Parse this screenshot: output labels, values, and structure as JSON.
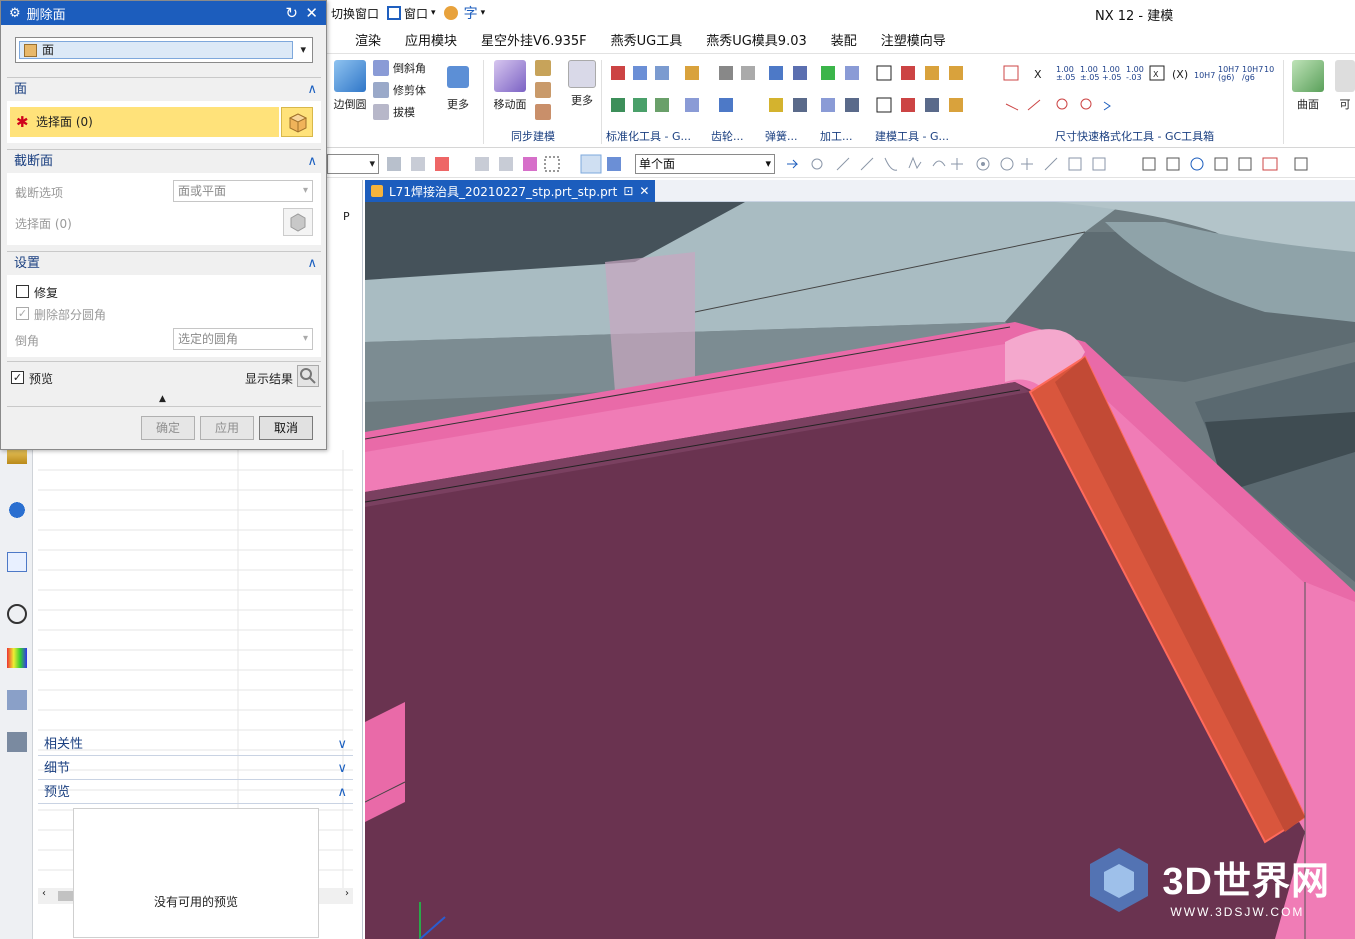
{
  "window": {
    "app_title": "NX 12 - 建模",
    "switch_window": "切换窗口",
    "window_menu": "窗口",
    "font_glyph": "字"
  },
  "menubar": [
    "渲染",
    "应用模块",
    "星空外挂V6.935F",
    "燕秀UG工具",
    "燕秀UG模具9.03",
    "装配",
    "注塑模向导"
  ],
  "ribbon": {
    "side_face": "边倒圆",
    "chamfer": "倒斜角",
    "trim_body": "修剪体",
    "draft": "拔模",
    "more_1": "更多",
    "move_face": "移动面",
    "more_2": "更多",
    "sync_modeling": "同步建模",
    "std_tools": "标准化工具 - G...",
    "gear": "齿轮...",
    "spring": "弹簧...",
    "machining": "加工...",
    "modeling_tools": "建模工具 - G...",
    "dim_tools": "尺寸快速格式化工具 - GC工具箱",
    "surface": "曲面",
    "right_cut": "可"
  },
  "toolbar2": {
    "filter_select": "单个面"
  },
  "doc_tab": {
    "name": "L71焊接治具_20210227_stp.prt_stp.prt"
  },
  "dialog": {
    "title": "删除面",
    "type_value": "面",
    "face_group": "面",
    "select_face": "选择面 (0)",
    "section_group": "截断面",
    "section_option_label": "截断选项",
    "section_option_value": "面或平面",
    "select_face_2": "选择面 (0)",
    "settings_group": "设置",
    "repair": "修复",
    "delete_partial_round": "删除部分圆角",
    "chamfer_label": "倒角",
    "chamfer_value": "选定的圆角",
    "preview_check": "预览",
    "show_result": "显示结果",
    "ok": "确定",
    "apply": "应用",
    "cancel": "取消"
  },
  "navigator": {
    "column_p": "P",
    "dependencies": "相关性",
    "details": "细节",
    "preview": "预览",
    "no_preview": "没有可用的预览"
  },
  "watermark": {
    "brand": "3D世界网",
    "url": "WWW.3DSJW.COM"
  },
  "colors": {
    "accent": "#1c5dbd",
    "selection_yellow": "#ffe27a",
    "part_pink": "#e96aa8",
    "part_dark": "#6a3350",
    "highlight_orange": "#d9563d"
  }
}
